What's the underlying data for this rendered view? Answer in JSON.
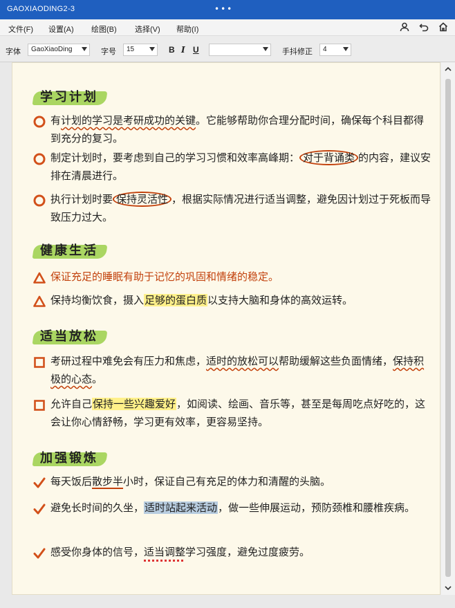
{
  "window": {
    "title": "GAOXIAODING2-3",
    "dots": "•••"
  },
  "menu": {
    "items": [
      "文件(F)",
      "设置(A)",
      "绘图(B)",
      "选择(V)",
      "帮助(I)"
    ],
    "icons": [
      "user-icon",
      "undo-icon",
      "home-icon"
    ]
  },
  "toolbar": {
    "font_label": "字体",
    "font_value": "GaoXiaoDing",
    "size_label": "字号",
    "size_value": "15",
    "bold": "B",
    "italic": "I",
    "underline": "U",
    "color_value": "",
    "correction_label": "手抖修正",
    "correction_value": "4"
  },
  "accent_colors": {
    "title_bar": "#1f5fbf",
    "highlight_green": "#9bd04a",
    "marker_orange": "#c2410c",
    "highlight_yellow": "#fff08a",
    "paper": "#fdf9ea"
  },
  "sections": [
    {
      "title": "学习计划",
      "bullet": "circle",
      "items": [
        {
          "parts": [
            "有",
            "计划的学习是考研成功的关键",
            "。它能够帮助你合理分配时间，确保每个科目都得到充分的复习。"
          ]
        },
        {
          "parts": [
            "制定计划时，要考虑到自己的学习习惯和效率高峰期：",
            "对于背诵类",
            "的内容，建议安排在清晨进行。"
          ]
        },
        {
          "parts": [
            "执行计划时要",
            "保持灵活性",
            "，根据实际情况进行适当调整，避免因计划过于死板而导致压力过大。"
          ]
        }
      ]
    },
    {
      "title": "健康生活",
      "bullet": "triangle",
      "items": [
        {
          "parts": [
            "保证充足的睡眠有助于记忆的巩固和情绪的稳定。"
          ]
        },
        {
          "parts": [
            "保持均衡饮食，摄入",
            "足够的蛋白质",
            "以支持大脑和身体的高效运转。"
          ]
        }
      ]
    },
    {
      "title": "适当放松",
      "bullet": "square",
      "items": [
        {
          "parts": [
            "考研过程中难免会有压力和焦虑，",
            "适时的放松可以",
            "帮助缓解这些负面情绪，",
            "保持积极的心态",
            "。"
          ]
        },
        {
          "parts": [
            "允许自己",
            "保持一些兴趣爱好",
            "，如阅读、绘画、音乐等，甚至是每周吃点好吃的，这会让你心情舒畅，学习更有效率，更容易坚持。"
          ]
        }
      ]
    },
    {
      "title": "加强锻炼",
      "bullet": "check",
      "items": [
        {
          "parts": [
            "每天饭后",
            "散步半",
            "小时，保证自己有充足的体力和清醒的头脑。"
          ]
        },
        {
          "parts": [
            "避免长时间的久坐，",
            "适时站起来活动",
            "，做一些伸展运动，预防颈椎和腰椎疾病。"
          ]
        },
        {
          "parts": [
            "感受你身体的信号，",
            "适当调整",
            "学习强度，避免过度疲劳。"
          ]
        }
      ]
    }
  ]
}
